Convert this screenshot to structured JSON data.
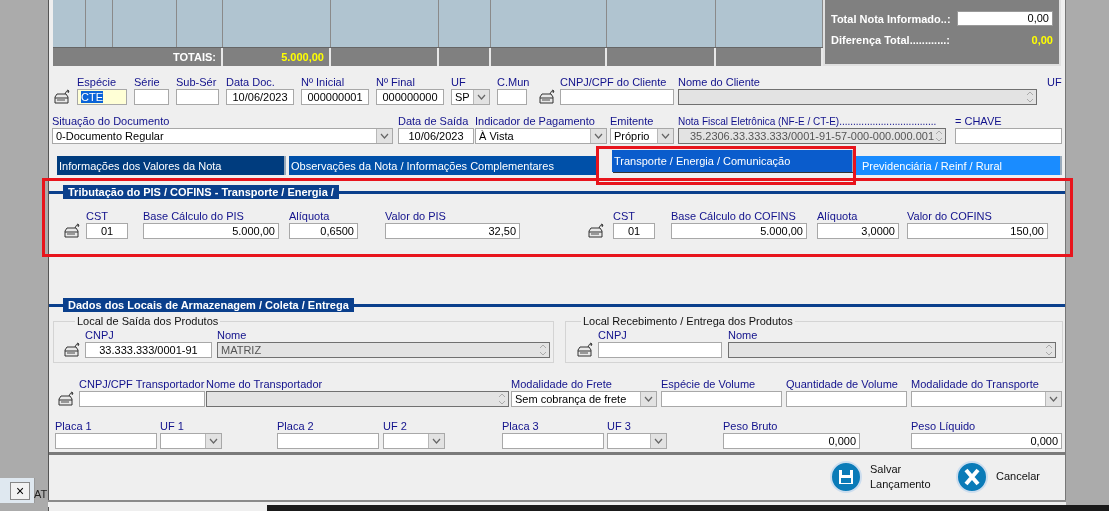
{
  "grid": {
    "totals_label": "TOTAIS:",
    "total_value": "5.000,00"
  },
  "summary": {
    "informed_label": "Total Nota Informado..:",
    "informed_value": "0,00",
    "difference_label": "Diferença Total............:",
    "difference_value": "0,00"
  },
  "document_row_1": [
    {
      "label": "Espécie",
      "value": "CTE",
      "kind": "text",
      "focused": true
    },
    {
      "label": "Série",
      "kind": "text"
    },
    {
      "label": "Sub-Sér",
      "kind": "text"
    },
    {
      "label": "Data Doc.",
      "value": "10/06/2023",
      "kind": "text"
    },
    {
      "label": "Nº Inicial",
      "value": "000000001",
      "kind": "text"
    },
    {
      "label": "Nº Final",
      "value": "000000000",
      "kind": "text"
    },
    {
      "label": "UF",
      "value": "SP",
      "kind": "select"
    },
    {
      "label": "C.Mun",
      "kind": "text"
    },
    {
      "label": "CNPJ/CPF do Cliente",
      "kind": "text"
    },
    {
      "label": "Nome do Cliente",
      "kind": "readonly"
    },
    {
      "label": "UF",
      "kind": "label"
    }
  ],
  "document_row_2": [
    {
      "label": "Situação do Documento",
      "value": "0-Documento Regular",
      "kind": "select"
    },
    {
      "label": "Data de Saída",
      "value": "10/06/2023",
      "kind": "text"
    },
    {
      "label": "Indicador de Pagamento",
      "value": "À Vista",
      "kind": "select"
    },
    {
      "label": "Emitente",
      "value": "Próprio",
      "kind": "select"
    },
    {
      "label": "Nota Fiscal Eletrônica (NF-E / CT-E)...................................",
      "value": "35.2306.33.333.333/0001-91-57-000-000.000.001",
      "kind": "readonly"
    },
    {
      "label": "=  CHAVE",
      "kind": "text"
    }
  ],
  "tabs": [
    {
      "label": "Informações dos Valores da Nota",
      "selected": false
    },
    {
      "label": "Observações da Nota / Informações Complementares",
      "selected": false
    },
    {
      "label": "Transporte / Energia / Comunicação",
      "selected": true
    },
    {
      "label": "Previdenciária / Reinf / Rural",
      "selected": false
    }
  ],
  "tax_section": {
    "title": "Tributação do PIS / COFINS - Transporte / Energia /",
    "fields": [
      {
        "label": "CST",
        "value": "01",
        "kind": "text"
      },
      {
        "label": "Base Cálculo do PIS",
        "value": "5.000,00",
        "kind": "text"
      },
      {
        "label": "Alíquota",
        "value": "0,6500",
        "kind": "text"
      },
      {
        "label": "Valor do PIS",
        "value": "32,50",
        "kind": "text"
      },
      {
        "label": "CST",
        "value": "01",
        "kind": "text"
      },
      {
        "label": "Base Cálculo do COFINS",
        "value": "5.000,00",
        "kind": "text"
      },
      {
        "label": "Alíquota",
        "value": "3,0000",
        "kind": "text"
      },
      {
        "label": "Valor do COFINS",
        "value": "150,00",
        "kind": "text"
      }
    ]
  },
  "locations_section": {
    "title": "Dados dos Locais de Armazenagem / Coleta / Entrega",
    "groups": [
      {
        "title": "Local de Saída dos Produtos",
        "fields": [
          {
            "label": "CNPJ",
            "value": "33.333.333/0001-91",
            "kind": "text"
          },
          {
            "label": "Nome",
            "value": "MATRIZ",
            "kind": "readonly"
          }
        ]
      },
      {
        "title": "Local Recebimento / Entrega dos Produtos",
        "fields": [
          {
            "label": "CNPJ",
            "kind": "text"
          },
          {
            "label": "Nome",
            "kind": "readonly"
          }
        ]
      }
    ],
    "transport_row": [
      {
        "label": "CNPJ/CPF Transportador",
        "kind": "text"
      },
      {
        "label": "Nome do Transportador",
        "kind": "readonly"
      },
      {
        "label": "Modalidade do Frete",
        "value": "Sem cobrança de frete",
        "kind": "select"
      },
      {
        "label": "Espécie de Volume",
        "kind": "text"
      },
      {
        "label": "Quantidade de Volume",
        "kind": "text"
      },
      {
        "label": "Modalidade do Transporte",
        "kind": "select"
      }
    ],
    "vehicle_row": [
      {
        "label": "Placa 1",
        "kind": "text"
      },
      {
        "label": "UF 1",
        "kind": "select"
      },
      {
        "label": "Placa 2",
        "kind": "text"
      },
      {
        "label": "UF 2",
        "kind": "select"
      },
      {
        "label": "Placa 3",
        "kind": "text"
      },
      {
        "label": "UF 3",
        "kind": "select"
      },
      {
        "label": "Peso Bruto",
        "value": "0,000",
        "kind": "text"
      },
      {
        "label": "Peso Líquido",
        "value": "0,000",
        "kind": "text"
      }
    ]
  },
  "actions": [
    {
      "label": "Salvar Lançamento",
      "kind": "save"
    },
    {
      "label": "Cancelar",
      "kind": "cancel"
    }
  ],
  "bottom_tab": {
    "close": "×",
    "label": "AT"
  }
}
